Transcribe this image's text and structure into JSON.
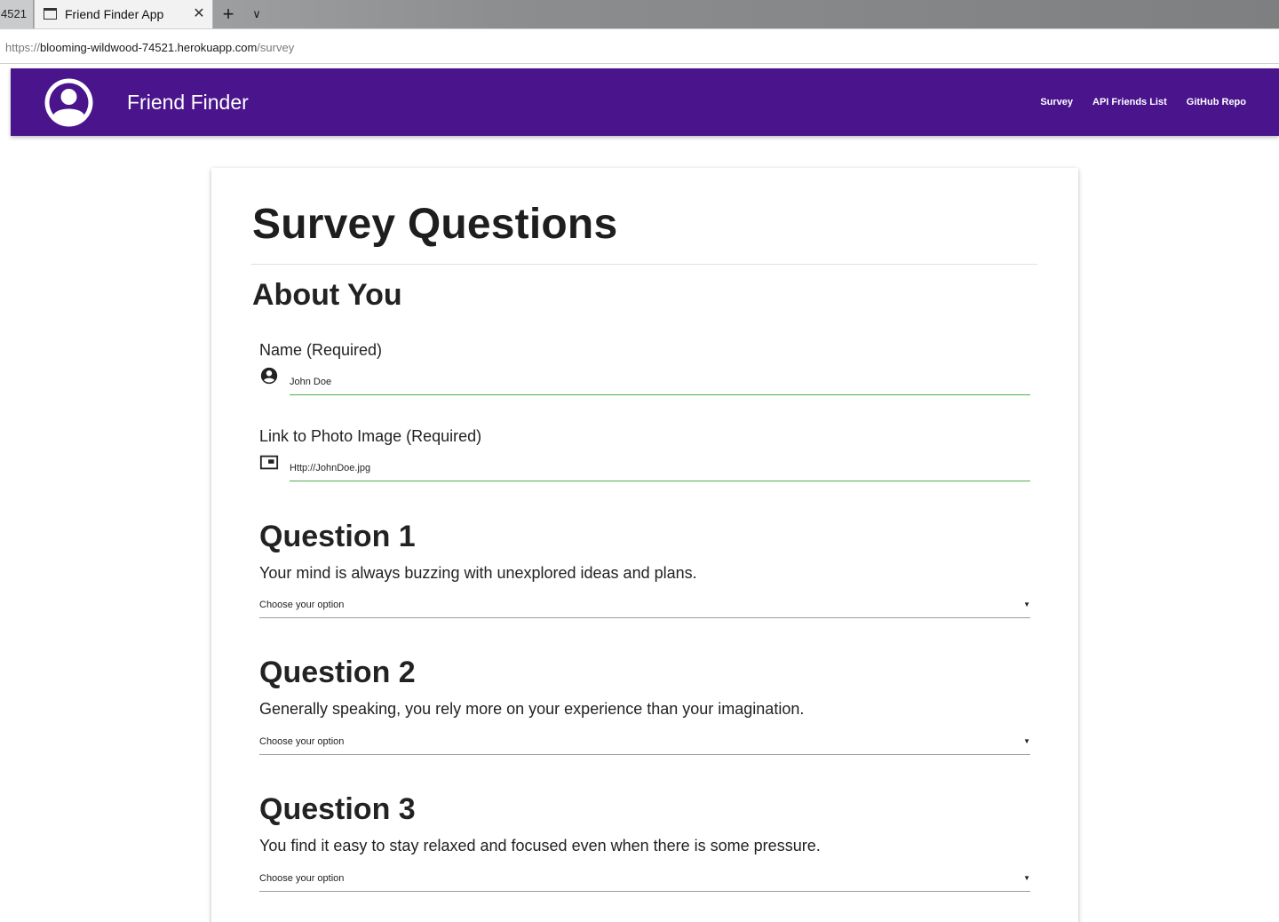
{
  "browser": {
    "prev_tab_label": "4521",
    "active_tab_title": "Friend Finder App",
    "url": {
      "scheme": "https://",
      "host": "blooming-wildwood-74521.herokuapp.com",
      "path": "/survey"
    }
  },
  "navbar": {
    "brand": "Friend Finder",
    "links": [
      "Survey",
      "API Friends List",
      "GitHub Repo"
    ],
    "background": "#4a148c"
  },
  "survey": {
    "title": "Survey Questions",
    "section": "About You",
    "name_field": {
      "label": "Name (Required)",
      "value": "John Doe",
      "icon": "account-circle-icon"
    },
    "photo_field": {
      "label": "Link to Photo Image (Required)",
      "value": "Http://JohnDoe.jpg",
      "icon": "picture-in-picture-icon"
    },
    "questions": [
      {
        "title": "Question 1",
        "text": "Your mind is always buzzing with unexplored ideas and plans.",
        "selected": "Choose your option"
      },
      {
        "title": "Question 2",
        "text": "Generally speaking, you rely more on your experience than your imagination.",
        "selected": "Choose your option"
      },
      {
        "title": "Question 3",
        "text": "You find it easy to stay relaxed and focused even when there is some pressure.",
        "selected": "Choose your option"
      }
    ],
    "accent_input_color": "#4caf50"
  }
}
